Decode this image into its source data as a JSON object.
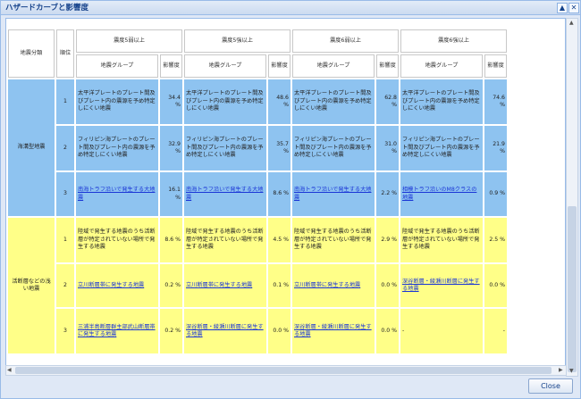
{
  "window": {
    "title": "ハザードカーブと影響度",
    "collapse_icon": "▲",
    "close_icon": "✕"
  },
  "table": {
    "col_category": "地震分類",
    "col_rank": "順位",
    "intensity_headers": [
      "震度5弱以上",
      "震度5強以上",
      "震度6弱以上",
      "震度6強以上"
    ],
    "sub_group": "地震グループ",
    "sub_influence": "影響度",
    "categories": [
      {
        "name": "海溝型地震",
        "color": "#8ec3f0",
        "rows": [
          {
            "rank": "1",
            "cells": [
              {
                "text": "太平洋プレートのプレート間及びプレート内の震源を予め特定しにくい地震",
                "value": "34.4 %",
                "link": false
              },
              {
                "text": "太平洋プレートのプレート間及びプレート内の震源を予め特定しにくい地震",
                "value": "48.6 %",
                "link": false
              },
              {
                "text": "太平洋プレートのプレート間及びプレート内の震源を予め特定しにくい地震",
                "value": "62.8 %",
                "link": false
              },
              {
                "text": "太平洋プレートのプレート間及びプレート内の震源を予め特定しにくい地震",
                "value": "74.6 %",
                "link": false
              }
            ]
          },
          {
            "rank": "2",
            "cells": [
              {
                "text": "フィリピン海プレートのプレート間及びプレート内の震源を予め特定しにくい地震",
                "value": "32.9 %",
                "link": false
              },
              {
                "text": "フィリピン海プレートのプレート間及びプレート内の震源を予め特定しにくい地震",
                "value": "35.7 %",
                "link": false
              },
              {
                "text": "フィリピン海プレートのプレート間及びプレート内の震源を予め特定しにくい地震",
                "value": "31.0 %",
                "link": false
              },
              {
                "text": "フィリピン海プレートのプレート間及びプレート内の震源を予め特定しにくい地震",
                "value": "21.9 %",
                "link": false
              }
            ]
          },
          {
            "rank": "3",
            "cells": [
              {
                "text": "南海トラフ沿いで発生する大地震",
                "value": "16.1 %",
                "link": true
              },
              {
                "text": "南海トラフ沿いで発生する大地震",
                "value": "8.6 %",
                "link": true
              },
              {
                "text": "南海トラフ沿いで発生する大地震",
                "value": "2.2 %",
                "link": true
              },
              {
                "text": "相模トラフ沿いのM8クラスの地震",
                "value": "0.9 %",
                "link": true
              }
            ]
          }
        ]
      },
      {
        "name": "活断層などの浅い地震",
        "color": "#ffff88",
        "rows": [
          {
            "rank": "1",
            "cells": [
              {
                "text": "陸域で発生する地震のうち活断層が特定されていない場所で発生する地震",
                "value": "8.6 %",
                "link": false
              },
              {
                "text": "陸域で発生する地震のうち活断層が特定されていない場所で発生する地震",
                "value": "4.5 %",
                "link": false
              },
              {
                "text": "陸域で発生する地震のうち活断層が特定されていない場所で発生する地震",
                "value": "2.9 %",
                "link": false
              },
              {
                "text": "陸域で発生する地震のうち活断層が特定されていない場所で発生する地震",
                "value": "2.5 %",
                "link": false
              }
            ]
          },
          {
            "rank": "2",
            "cells": [
              {
                "text": "立川断層帯に発生する地震",
                "value": "0.2 %",
                "link": true
              },
              {
                "text": "立川断層帯に発生する地震",
                "value": "0.1 %",
                "link": true
              },
              {
                "text": "立川断層帯に発生する地震",
                "value": "0.0 %",
                "link": true
              },
              {
                "text": "深谷断層・綾瀬川断層に発生する地震",
                "value": "0.0 %",
                "link": true
              }
            ]
          },
          {
            "rank": "3",
            "cells": [
              {
                "text": "三浦半島断層群主部武山断層帯に発生する地震",
                "value": "0.2 %",
                "link": true
              },
              {
                "text": "深谷断層・綾瀬川断層に発生する地震",
                "value": "0.0 %",
                "link": true
              },
              {
                "text": "深谷断層・綾瀬川断層に発生する地震",
                "value": "0.0 %",
                "link": true
              },
              {
                "text": "-",
                "value": "-",
                "link": false
              }
            ]
          }
        ]
      }
    ]
  },
  "footer": {
    "close_label": "Close"
  }
}
